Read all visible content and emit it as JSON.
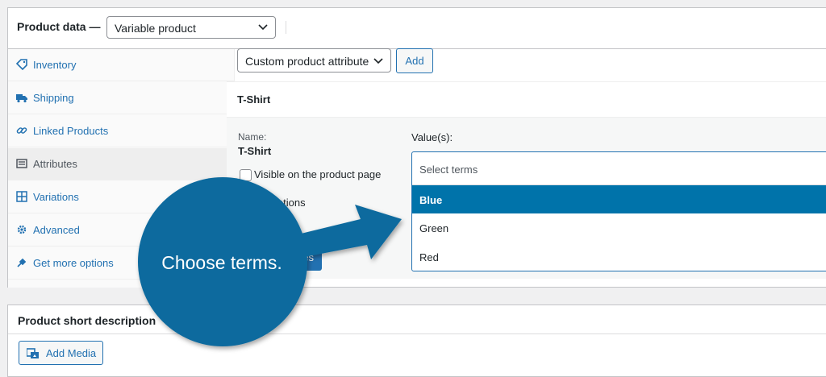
{
  "product_data": {
    "title": "Product data —",
    "type_value": "Variable product"
  },
  "tabs": [
    {
      "label": "Inventory",
      "icon": "tag-icon",
      "active": false
    },
    {
      "label": "Shipping",
      "icon": "truck-icon",
      "active": false
    },
    {
      "label": "Linked Products",
      "icon": "link-icon",
      "active": false
    },
    {
      "label": "Attributes",
      "icon": "list-icon",
      "active": true
    },
    {
      "label": "Variations",
      "icon": "grid-icon",
      "active": false
    },
    {
      "label": "Advanced",
      "icon": "gear-icon",
      "active": false
    },
    {
      "label": "Get more options",
      "icon": "plugin-icon",
      "active": false
    }
  ],
  "toolbar": {
    "attribute_select_value": "Custom product attribute",
    "add_label": "Add"
  },
  "attribute": {
    "title": "T-Shirt",
    "name_label": "Name:",
    "name_value": "T-Shirt",
    "values_label": "Value(s):",
    "visible_label": "Visible on the product page",
    "variations_label": "r variations",
    "save_label": "es"
  },
  "terms": {
    "placeholder": "Select terms",
    "options": [
      {
        "label": "Blue",
        "highlighted": true
      },
      {
        "label": "Green",
        "highlighted": false
      },
      {
        "label": "Red",
        "highlighted": false
      }
    ]
  },
  "short_description": {
    "title": "Product short description",
    "add_media_label": "Add Media"
  },
  "callout": {
    "text": "Choose terms.",
    "color": "#0b6a9e"
  },
  "colors": {
    "accent": "#2271b1",
    "highlight": "#0073aa",
    "border": "#c3c4c7"
  }
}
